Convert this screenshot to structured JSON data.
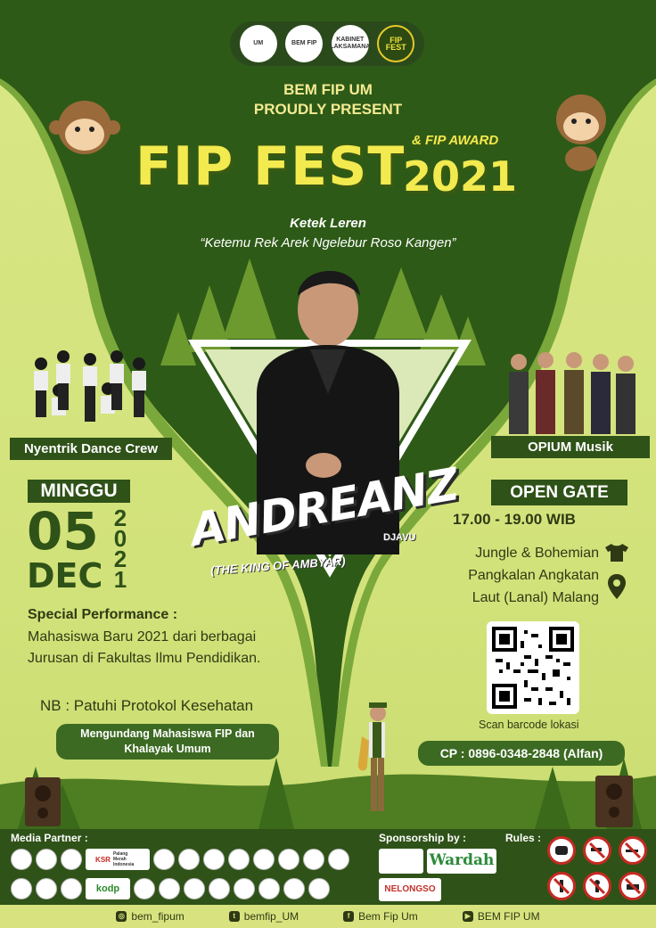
{
  "header": {
    "logos": [
      {
        "name": "um-logo",
        "text": "UM"
      },
      {
        "name": "bem-fip-logo",
        "text": "BEM FIP"
      },
      {
        "name": "kabinet-logo",
        "text": "KABINET LAKSAMANA"
      },
      {
        "name": "fip-fest-logo",
        "text": "FIP FEST"
      }
    ],
    "line1": "BEM FIP UM",
    "line2": "PROUDLY PRESENT",
    "title": "FIP FEST",
    "award": "& FIP AWARD",
    "year": "2021",
    "tagline_title": "Ketek Leren",
    "tagline": "“Ketemu Rek Arek Ngelebur Roso Kangen”"
  },
  "performers": {
    "left_label": "Nyentrik Dance Crew",
    "right_label": "OPIUM Musik",
    "headliner": "ANDREANZ",
    "headliner_sub": "(THE KING OF AMBYAR)",
    "headliner_label": "DJAVU"
  },
  "event": {
    "day": "MINGGU",
    "date": "05",
    "month": "DEC",
    "year_digits": [
      "2",
      "0",
      "2",
      "1"
    ],
    "special_title": "Special Performance :",
    "special_body": "Mahasiswa Baru 2021 dari berbagai Jurusan di Fakultas Ilmu Pendidikan.",
    "nb": "NB : Patuhi Protokol Kesehatan",
    "invite": "Mengundang Mahasiswa FIP dan Khalayak Umum",
    "gate_label": "OPEN GATE",
    "gate_time": "17.00 - 19.00 WIB",
    "venue_line1": "Jungle & Bohemian",
    "venue_line2": "Pangkalan Angkatan",
    "venue_line3": "Laut (Lanal) Malang",
    "scan": "Scan barcode lokasi",
    "contact": "CP : 0896-0348-2848 (Alfan)"
  },
  "footer": {
    "media_partner": "Media Partner :",
    "sponsorship": "Sponsorship by :",
    "rules": "Rules :",
    "sponsors": [
      "Wardah",
      "NELONGSO"
    ],
    "partner_texts": [
      "KSR",
      "Palang Merah Indonesia",
      "kodp"
    ],
    "rule_icons": [
      "mask-icon",
      "no-weapon-icon",
      "no-smoking-icon",
      "no-alcohol-icon",
      "no-littering-icon",
      "no-vehicle-icon"
    ],
    "socials": [
      {
        "icon": "instagram-icon",
        "text": "bem_fipum"
      },
      {
        "icon": "twitter-icon",
        "text": "bemfip_UM"
      },
      {
        "icon": "facebook-icon",
        "text": "Bem Fip Um"
      },
      {
        "icon": "youtube-icon",
        "text": "BEM FIP UM"
      }
    ]
  },
  "colors": {
    "dark_green": "#2f5218",
    "lime": "#d2e27a",
    "title_yellow": "#f2ea4f"
  }
}
